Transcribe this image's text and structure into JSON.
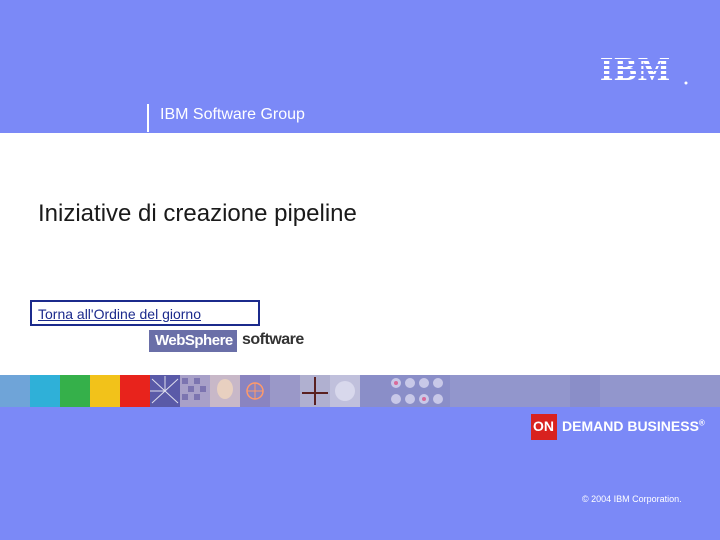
{
  "header": {
    "group_label": "IBM Software Group",
    "logo_text": "IBM"
  },
  "main": {
    "title": "Iniziative di creazione pipeline",
    "agenda_link": "Torna all'Ordine del giorno"
  },
  "branding": {
    "websphere_label": "WebSphere",
    "software_label": "software",
    "on_label": "ON",
    "demand_business_label": "DEMAND BUSINESS",
    "trademark": "®"
  },
  "footer": {
    "copyright": "© 2004 IBM Corporation."
  },
  "colors": {
    "background_blue": "#7b89f7",
    "link_blue": "#1b2a8c",
    "on_red": "#d8221f",
    "websphere_purple": "#6a6fa8"
  }
}
